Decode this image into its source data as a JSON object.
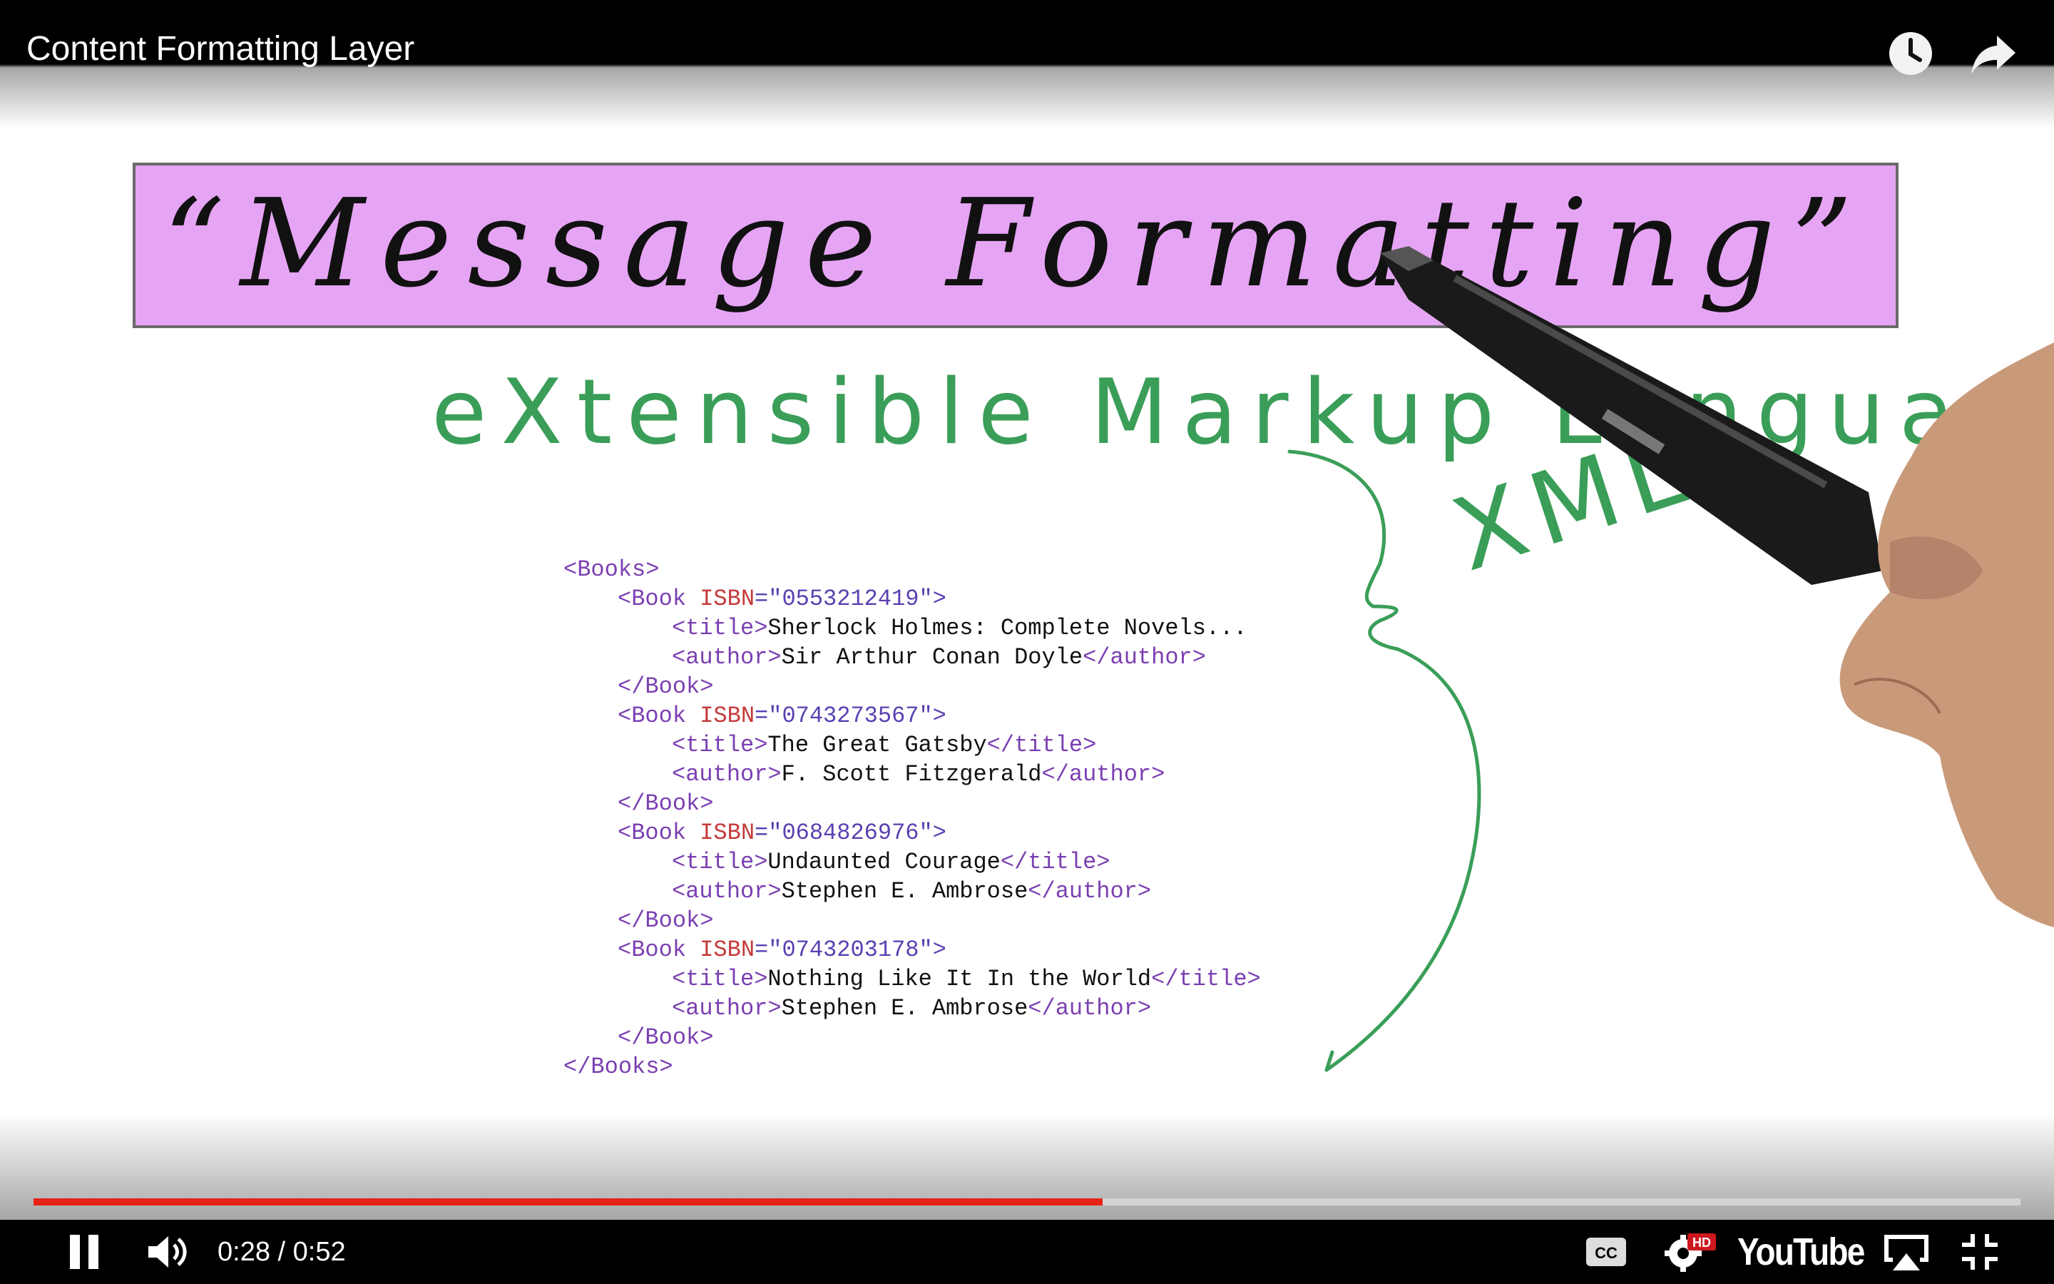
{
  "player": {
    "title": "Content Formatting Layer",
    "time_current": "0:28",
    "time_separator": " / ",
    "time_total": "0:52",
    "progress_fraction": 0.538,
    "brand": "YouTube",
    "hd_badge": "HD",
    "colors": {
      "progress": "#e62117",
      "banner": "#e6a5f4",
      "ink_green": "#3a9e58"
    },
    "icons": [
      "watch-later-icon",
      "share-icon",
      "pause-icon",
      "volume-icon",
      "captions-icon",
      "settings-icon",
      "airplay-icon",
      "exit-fullscreen-icon"
    ]
  },
  "slide": {
    "banner_text": "“Message Formatting”",
    "heading": "eXtensible Markup Language",
    "annotation": "XML",
    "xml_lines": [
      {
        "indent": 0,
        "parts": [
          {
            "t": "tag",
            "v": "<Books>"
          }
        ]
      },
      {
        "indent": 1,
        "parts": [
          {
            "t": "tag",
            "v": "<Book "
          },
          {
            "t": "attr",
            "v": "ISBN"
          },
          {
            "t": "val",
            "v": "=\"0553212419\">"
          }
        ]
      },
      {
        "indent": 2,
        "parts": [
          {
            "t": "tag",
            "v": "<title>"
          },
          {
            "t": "txt",
            "v": "Sherlock Holmes: Complete Novels..."
          }
        ]
      },
      {
        "indent": 2,
        "parts": [
          {
            "t": "tag",
            "v": "<author>"
          },
          {
            "t": "txt",
            "v": "Sir Arthur Conan Doyle"
          },
          {
            "t": "tag",
            "v": "</author>"
          }
        ]
      },
      {
        "indent": 1,
        "parts": [
          {
            "t": "tag",
            "v": "</Book>"
          }
        ]
      },
      {
        "indent": 1,
        "parts": [
          {
            "t": "tag",
            "v": "<Book "
          },
          {
            "t": "attr",
            "v": "ISBN"
          },
          {
            "t": "val",
            "v": "=\"0743273567\">"
          }
        ]
      },
      {
        "indent": 2,
        "parts": [
          {
            "t": "tag",
            "v": "<title>"
          },
          {
            "t": "txt",
            "v": "The Great Gatsby"
          },
          {
            "t": "tag",
            "v": "</title>"
          }
        ]
      },
      {
        "indent": 2,
        "parts": [
          {
            "t": "tag",
            "v": "<author>"
          },
          {
            "t": "txt",
            "v": "F. Scott Fitzgerald"
          },
          {
            "t": "tag",
            "v": "</author>"
          }
        ]
      },
      {
        "indent": 1,
        "parts": [
          {
            "t": "tag",
            "v": "</Book>"
          }
        ]
      },
      {
        "indent": 1,
        "parts": [
          {
            "t": "tag",
            "v": "<Book "
          },
          {
            "t": "attr",
            "v": "ISBN"
          },
          {
            "t": "val",
            "v": "=\"0684826976\">"
          }
        ]
      },
      {
        "indent": 2,
        "parts": [
          {
            "t": "tag",
            "v": "<title>"
          },
          {
            "t": "txt",
            "v": "Undaunted Courage"
          },
          {
            "t": "tag",
            "v": "</title>"
          }
        ]
      },
      {
        "indent": 2,
        "parts": [
          {
            "t": "tag",
            "v": "<author>"
          },
          {
            "t": "txt",
            "v": "Stephen E. Ambrose"
          },
          {
            "t": "tag",
            "v": "</author>"
          }
        ]
      },
      {
        "indent": 1,
        "parts": [
          {
            "t": "tag",
            "v": "</Book>"
          }
        ]
      },
      {
        "indent": 1,
        "parts": [
          {
            "t": "tag",
            "v": "<Book "
          },
          {
            "t": "attr",
            "v": "ISBN"
          },
          {
            "t": "val",
            "v": "=\"0743203178\">"
          }
        ]
      },
      {
        "indent": 2,
        "parts": [
          {
            "t": "tag",
            "v": "<title>"
          },
          {
            "t": "txt",
            "v": "Nothing Like It In the World"
          },
          {
            "t": "tag",
            "v": "</title>"
          }
        ]
      },
      {
        "indent": 2,
        "parts": [
          {
            "t": "tag",
            "v": "<author>"
          },
          {
            "t": "txt",
            "v": "Stephen E. Ambrose"
          },
          {
            "t": "tag",
            "v": "</author>"
          }
        ]
      },
      {
        "indent": 1,
        "parts": [
          {
            "t": "tag",
            "v": "</Book>"
          }
        ]
      },
      {
        "indent": 0,
        "parts": [
          {
            "t": "tag",
            "v": "</Books>"
          }
        ]
      }
    ]
  }
}
